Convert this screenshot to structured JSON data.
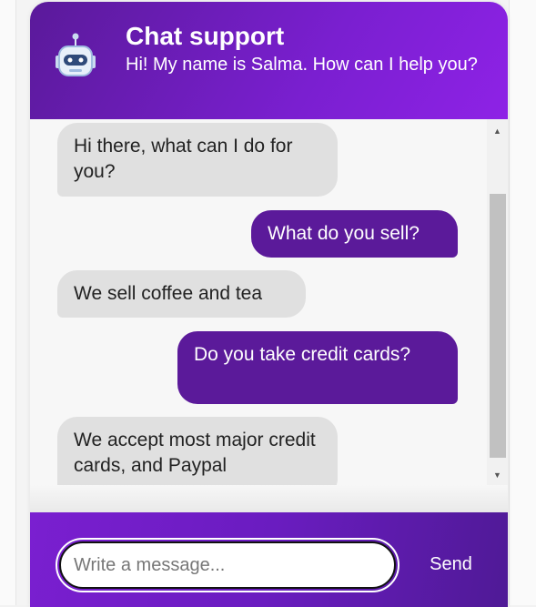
{
  "header": {
    "title": "Chat support",
    "subtitle": "Hi! My name is Salma. How can I help you?",
    "icon": "robot-icon"
  },
  "messages": [
    {
      "sender": "bot",
      "text": "Hi there, what can I do for you?"
    },
    {
      "sender": "user",
      "text": "What do you sell?"
    },
    {
      "sender": "bot",
      "text": "We sell coffee and tea"
    },
    {
      "sender": "user",
      "text": "Do you take credit cards?"
    },
    {
      "sender": "bot",
      "text": "We accept most major credit cards, and Paypal"
    }
  ],
  "composer": {
    "placeholder": "Write a message...",
    "value": "",
    "send_label": "Send"
  },
  "colors": {
    "header_start": "#5a1a9a",
    "header_end": "#8e22e6",
    "user_bubble": "#5b1a9a",
    "bot_bubble": "#e0e0e0"
  }
}
